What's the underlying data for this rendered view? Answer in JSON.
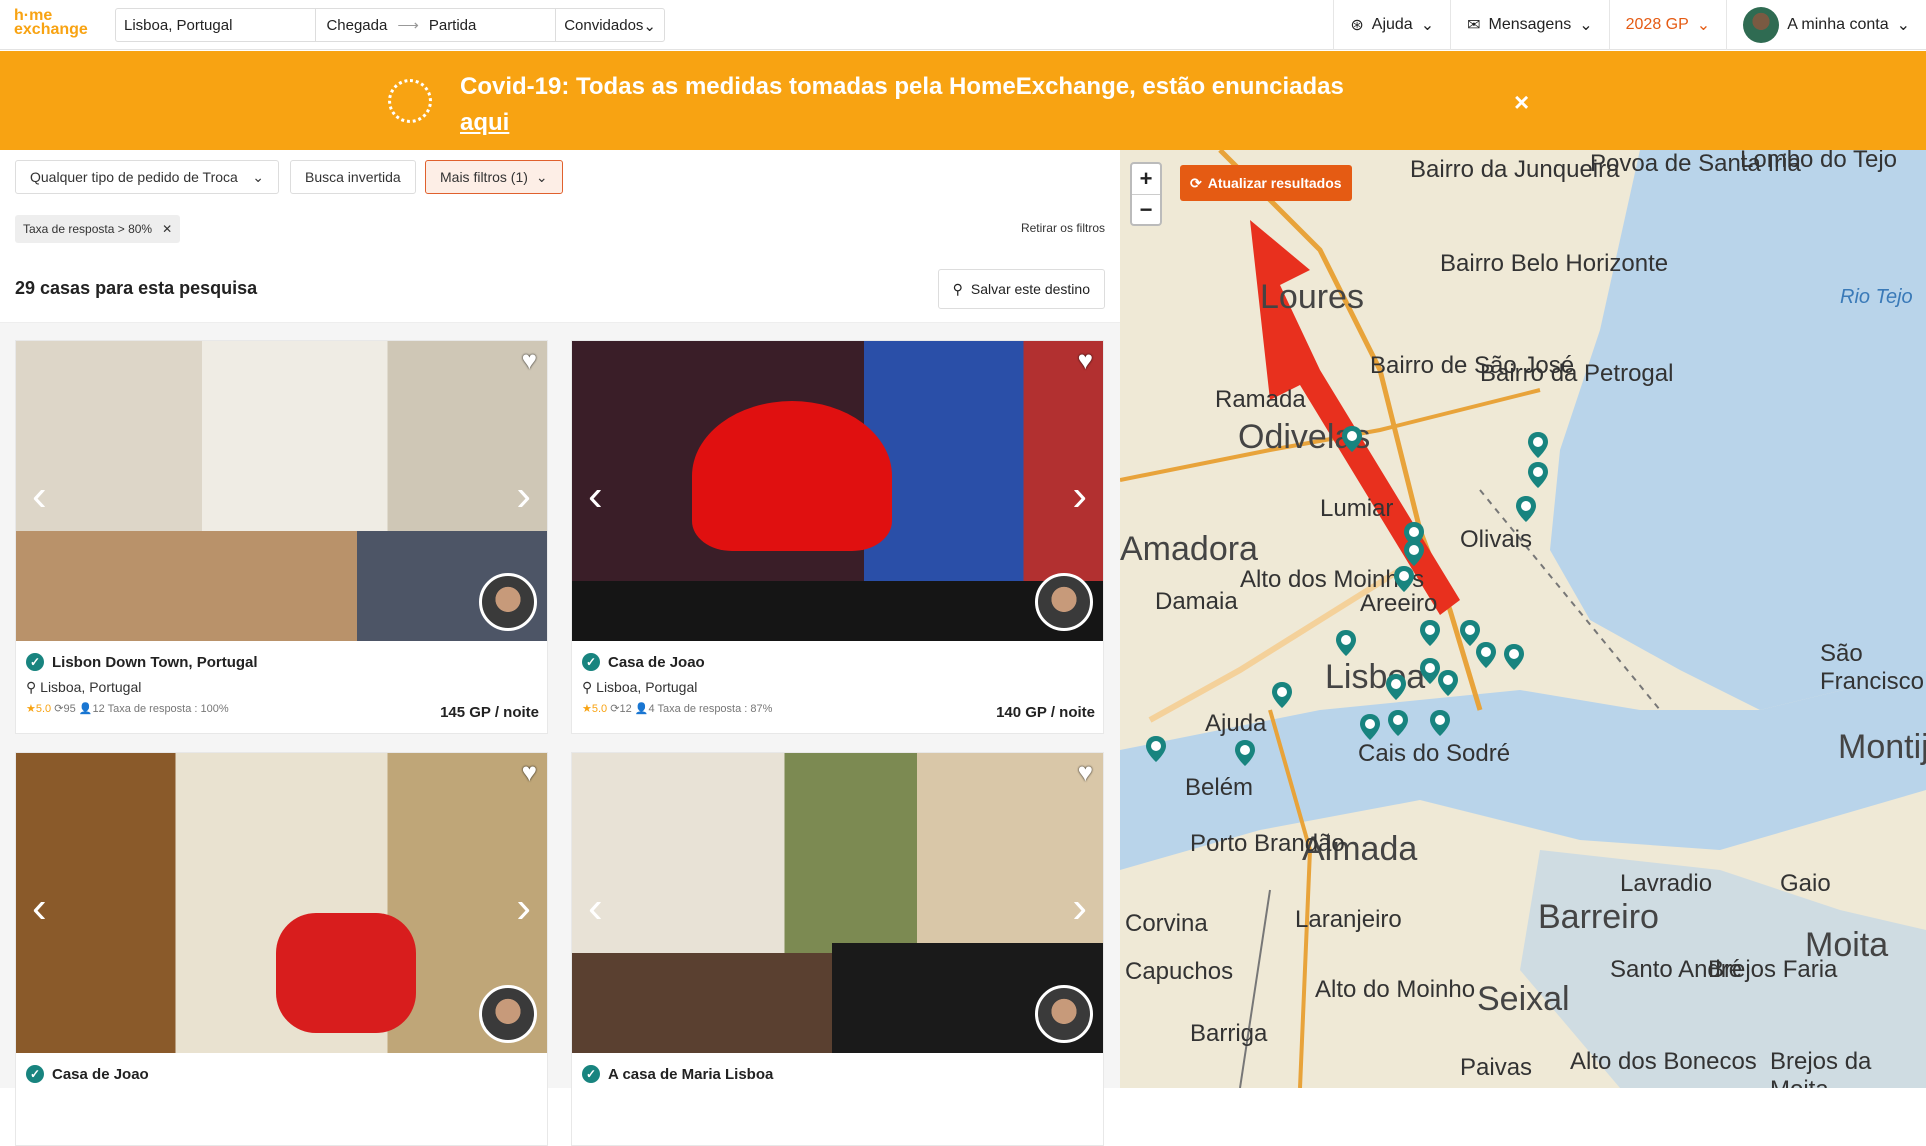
{
  "header": {
    "logo_line1": "h·me",
    "logo_line2": "exchange",
    "search_destination": "Lisboa, Portugal",
    "arrival": "Chegada",
    "departure": "Partida",
    "guests": "Convidados",
    "help": "Ajuda",
    "messages": "Mensagens",
    "guest_points": "2028 GP",
    "account": "A minha conta"
  },
  "banner": {
    "text": "Covid-19: Todas as medidas tomadas pela HomeExchange, estão enunciadas",
    "link": "aqui",
    "close": "×"
  },
  "filters": {
    "exchange_type": "Qualquer tipo de pedido de Troca",
    "reverse_search": "Busca invertida",
    "more_filters": "Mais filtros (1)",
    "active_chip": "Taxa de resposta > 80%",
    "remove_filters": "Retirar os filtros",
    "results_count": "29 casas para esta pesquisa",
    "save_destination": "Salvar este destino"
  },
  "listings": [
    {
      "title": "Lisbon Down Town, Portugal",
      "location": "Lisboa, Portugal",
      "rating": "5.0",
      "reviews": "95",
      "guests": "12",
      "response_rate": "Taxa de resposta : 100%",
      "price": "145 GP / noite",
      "img_color": "#d9d4c9"
    },
    {
      "title": "Casa de Joao",
      "location": "Lisboa, Portugal",
      "rating": "5.0",
      "reviews": "12",
      "guests": "4",
      "response_rate": "Taxa de resposta : 87%",
      "price": "140 GP / noite",
      "img_color": "#3a1e28"
    },
    {
      "title": "Casa de Joao",
      "img_color": "#cbb58e"
    },
    {
      "title": "A casa de Maria Lisboa",
      "img_color": "#6b4a3a"
    }
  ],
  "map": {
    "update_button": "Atualizar resultados",
    "zoom_in": "+",
    "zoom_out": "−",
    "labels": [
      "Bairro da Junqueira",
      "Povoa de Santa Iria",
      "Lombo do Tejo",
      "Loures",
      "Bairro Belo Horizonte",
      "Rio Tejo",
      "Bairro de São José",
      "Bairro da Petrogal",
      "Ramada",
      "Odivelas",
      "Lumiar",
      "Olivais",
      "Alto dos Moinhos",
      "Areeiro",
      "Lisboa",
      "Ajuda",
      "Belém",
      "Almada",
      "Laranjeiro",
      "Barreiro",
      "Seixal",
      "Moita",
      "Montijo",
      "São Francisco",
      "Porto Brandão",
      "Lavradio",
      "Gaio",
      "Santo André",
      "Brejos Faria",
      "Capuchos",
      "Alto do Moinho",
      "Barriga",
      "Paivas",
      "Alto dos Bonecos",
      "Brejos da Moita",
      "Corvina",
      "Cais do Sodré",
      "Amadora",
      "Damaia"
    ]
  }
}
